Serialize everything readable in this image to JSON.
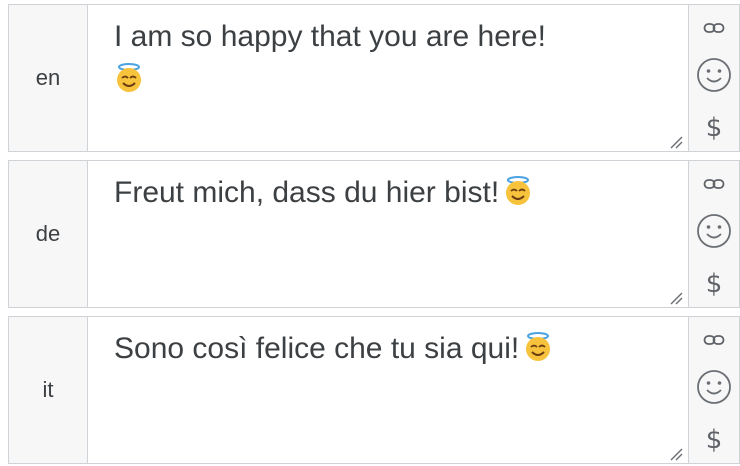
{
  "rows": [
    {
      "lang": "en",
      "text": "I am so happy that you are here!",
      "emoji": "smiling-face-with-halo"
    },
    {
      "lang": "de",
      "text": "Freut mich, dass du hier bist!",
      "emoji": "smiling-face-with-halo"
    },
    {
      "lang": "it",
      "text": "Sono così felice che tu sia qui!",
      "emoji": "smiling-face-with-halo"
    }
  ],
  "tools": {
    "link_icon": "link-icon",
    "emoji_icon": "emoji-picker-icon",
    "dollar_label": "$"
  },
  "colors": {
    "border": "#cfd3d8",
    "label_bg": "#f7f7f8",
    "text": "#3c4043",
    "icon": "#5f6368"
  }
}
